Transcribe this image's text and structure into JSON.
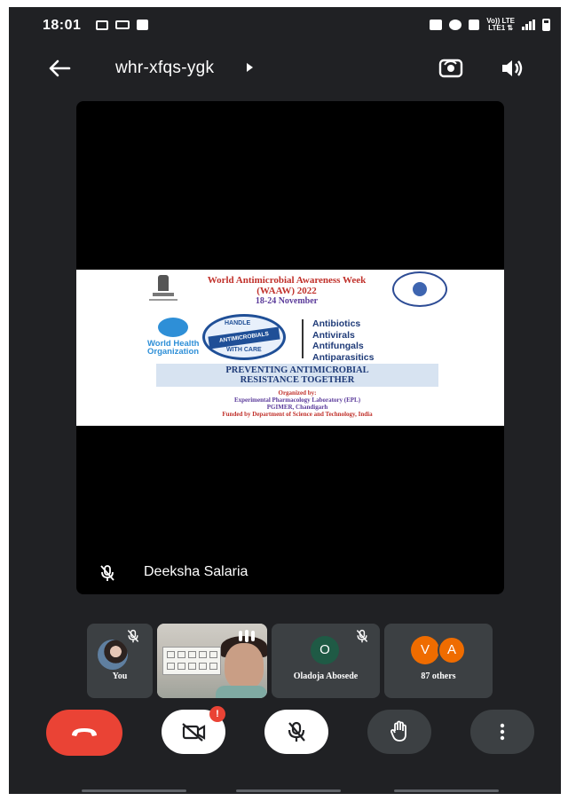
{
  "status_bar": {
    "time": "18:01",
    "network_label": "Vo)) LTE",
    "network_sub": "LTE1 ⇅"
  },
  "top_bar": {
    "meeting_code": "whr-xfqs-ygk"
  },
  "main_tile": {
    "participant_name": "Deeksha Salaria",
    "slide": {
      "title_line1": "World Antimicrobial Awareness Week",
      "title_line2": "(WAAW) 2022",
      "date": "18-24 November",
      "who_line1": "World Health",
      "who_line2": "Organization",
      "badge_top": "HANDLE",
      "badge_middle": "ANTIMICROBIALS",
      "badge_bottom": "WITH CARE",
      "drugs": [
        "Antibiotics",
        "Antivirals",
        "Antifungals",
        "Antiparasitics"
      ],
      "slogan_line1": "PREVENTING ANTIMICROBIAL",
      "slogan_line2": "RESISTANCE TOGETHER",
      "organized_by": "Organized by:",
      "org_line1": "Experimental Pharmacology Laboratory (EPL)",
      "org_line2": "PGIMER, Chandigarh",
      "funded_by": "Funded by Department of Science and Technology, India"
    }
  },
  "participants": {
    "you_label": "You",
    "oladoja": {
      "initial": "O",
      "name": "Oladoja Abosede"
    },
    "others": {
      "initials": [
        "V",
        "A"
      ],
      "label": "87 others"
    }
  },
  "controls": {
    "camera_alert": "!"
  },
  "colors": {
    "background": "#202124",
    "tile": "#3c4043",
    "end_call": "#ea4335",
    "avatar_o": "#1f5a45",
    "avatar_orange": "#ef6c00"
  }
}
